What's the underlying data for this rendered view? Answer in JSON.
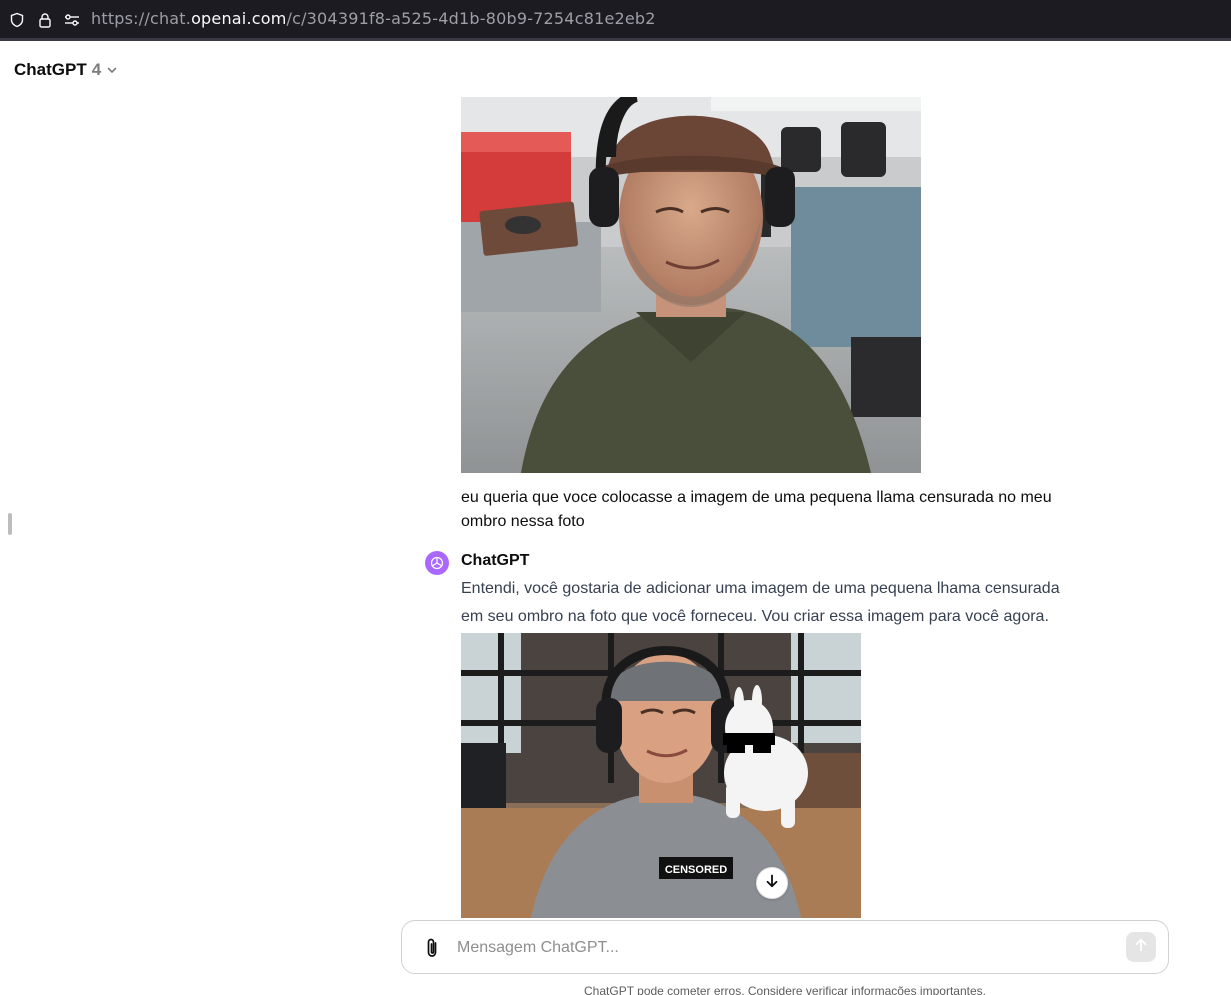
{
  "browser": {
    "url_prefix": "https://chat.",
    "url_host": "openai.com",
    "url_path": "/c/304391f8-a525-4d1b-80b9-7254c81e2eb2",
    "icons": [
      "shield-icon",
      "lock-icon",
      "permissions-icon"
    ]
  },
  "header": {
    "model_name": "ChatGPT",
    "model_version": "4",
    "dropdown_icon": "chevron-down-icon"
  },
  "conversation": {
    "user_message": {
      "image": "photo of a man wearing a brown cap and headphones in an office",
      "text": "eu queria que voce colocasse a imagem de uma pequena llama censurada no meu ombro nessa foto"
    },
    "assistant_message": {
      "author": "ChatGPT",
      "text": "Entendi, você gostaria de adicionar uma imagem de uma pequena lhama censurada em seu ombro na foto que você forneceu. Vou criar essa imagem para você agora.",
      "image": "generated image of the man with a small white llama wearing pixel sunglasses on his shoulder",
      "image_label": "CENSORED"
    }
  },
  "composer": {
    "placeholder": "Mensagem ChatGPT...",
    "attach_icon": "paperclip-icon",
    "send_icon": "arrow-up-icon",
    "scroll_icon": "arrow-down-icon"
  },
  "footer": {
    "disclaimer": "ChatGPT pode cometer erros. Considere verificar informações importantes."
  }
}
